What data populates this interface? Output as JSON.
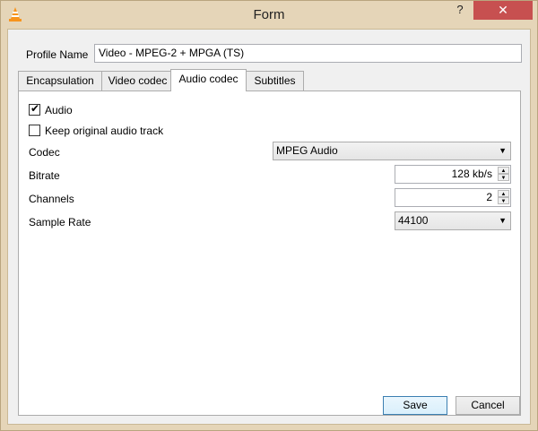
{
  "window": {
    "title": "Form",
    "help_symbol": "?",
    "close_symbol": "✕",
    "icon": "vlc-cone-icon"
  },
  "profile": {
    "label": "Profile Name",
    "value": "Video - MPEG-2 + MPGA (TS)"
  },
  "tabs": [
    {
      "label": "Encapsulation",
      "active": false
    },
    {
      "label": "Video codec",
      "active": false
    },
    {
      "label": "Audio codec",
      "active": true
    },
    {
      "label": "Subtitles",
      "active": false
    }
  ],
  "audio": {
    "audio_checkbox": {
      "label": "Audio",
      "checked": true
    },
    "keep_original": {
      "label": "Keep original audio track",
      "checked": false
    },
    "codec": {
      "label": "Codec",
      "value": "MPEG Audio"
    },
    "bitrate": {
      "label": "Bitrate",
      "value": "128 kb/s"
    },
    "channels": {
      "label": "Channels",
      "value": "2"
    },
    "sample_rate": {
      "label": "Sample Rate",
      "value": "44100"
    }
  },
  "buttons": {
    "save": "Save",
    "cancel": "Cancel"
  },
  "glyphs": {
    "check": "✔",
    "dropdown": "▼",
    "spin_up": "▲",
    "spin_down": "▼"
  },
  "colors": {
    "frame": "#e5d5b8",
    "close": "#c75050",
    "client": "#f0f0f0"
  }
}
